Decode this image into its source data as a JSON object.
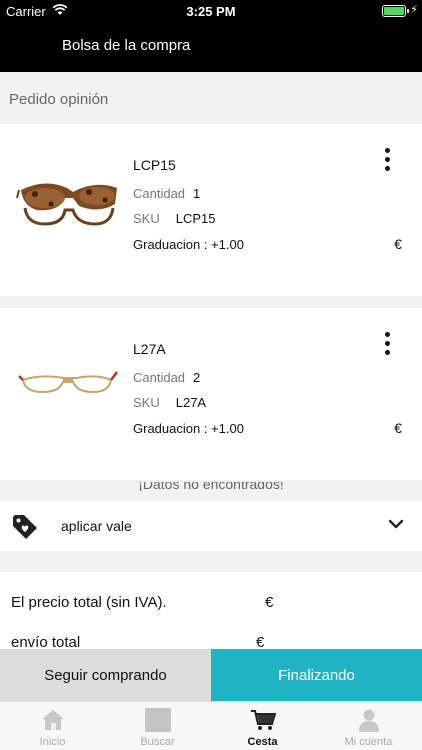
{
  "status_bar": {
    "carrier": "Carrier",
    "time": "3:25 PM"
  },
  "header": {
    "title": "Bolsa de la compra"
  },
  "section": {
    "title": "Pedido opinión"
  },
  "items": [
    {
      "name": "LCP15",
      "qty_label": "Cantidad",
      "qty": "1",
      "sku_label": "SKU",
      "sku": "LCP15",
      "grad": "Graduacion  : +1.00",
      "price": "€"
    },
    {
      "name": "L27A",
      "qty_label": "Cantidad",
      "qty": "2",
      "sku_label": "SKU",
      "sku": "L27A",
      "grad": "Graduacion  : +1.00",
      "price": "€"
    }
  ],
  "not_found": "¡Datos no encontrados!",
  "voucher": {
    "label": "aplicar vale"
  },
  "totals": {
    "net_label": "El precio total (sin IVA).",
    "net_value": "€",
    "shipping_label": "envío total",
    "shipping_value": "€"
  },
  "actions": {
    "continue": "Seguir comprando",
    "finish": "Finalizando"
  },
  "tabs": [
    {
      "label": "Inicio",
      "icon": "home-icon"
    },
    {
      "label": "Buscar",
      "icon": "search-icon"
    },
    {
      "label": "Cesta",
      "icon": "cart-icon",
      "active": true
    },
    {
      "label": "Mi cuenta",
      "icon": "user-icon"
    }
  ],
  "colors": {
    "accent": "#1fb3c4",
    "header": "#000000",
    "battery": "#4cd964"
  }
}
